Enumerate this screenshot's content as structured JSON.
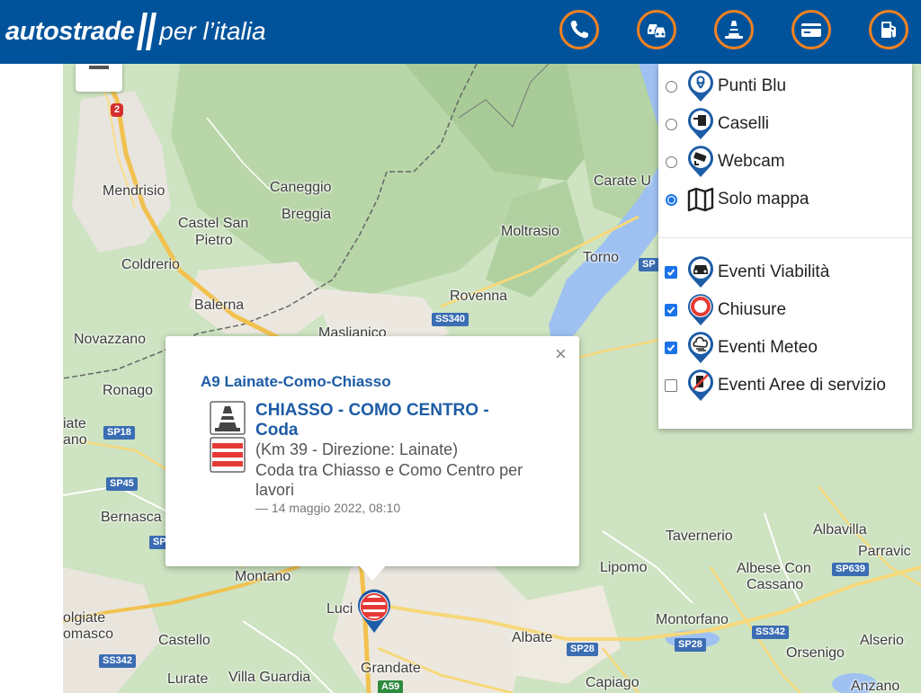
{
  "header": {
    "brand": "autostrade",
    "brand_sub": "per l’italia",
    "colors": {
      "bar": "#00539b",
      "accent": "#f58220"
    },
    "nav": [
      {
        "name": "phone-icon"
      },
      {
        "name": "traffic-cars-icon"
      },
      {
        "name": "roadworks-cone-icon"
      },
      {
        "name": "payment-card-icon"
      },
      {
        "name": "fuel-pump-icon"
      }
    ]
  },
  "map": {
    "places": [
      {
        "label": "Mendrisio"
      },
      {
        "label": "Caneggio"
      },
      {
        "label": "Breggia"
      },
      {
        "label": "Castel San"
      },
      {
        "label": "Pietro"
      },
      {
        "label": "Coldrerio"
      },
      {
        "label": "Balerna"
      },
      {
        "label": "Novazzano"
      },
      {
        "label": "Maslianico"
      },
      {
        "label": "Ronago"
      },
      {
        "label": "Moltrasio"
      },
      {
        "label": "Rovenna"
      },
      {
        "label": "Torno"
      },
      {
        "label": "Carate U"
      },
      {
        "label": "iate"
      },
      {
        "label": "ano"
      },
      {
        "label": "Bernasca"
      },
      {
        "label": "Montano"
      },
      {
        "label": "Luci"
      },
      {
        "label": "olgiate"
      },
      {
        "label": "omasco"
      },
      {
        "label": "Castello"
      },
      {
        "label": "Lurate"
      },
      {
        "label": "Villa Guardia"
      },
      {
        "label": "Grandate"
      },
      {
        "label": "Albate"
      },
      {
        "label": "Capiago"
      },
      {
        "label": "Tavernerio"
      },
      {
        "label": "Albavilla"
      },
      {
        "label": "Parravic"
      },
      {
        "label": "Lipomo"
      },
      {
        "label": "Albese Con"
      },
      {
        "label": "Cassano"
      },
      {
        "label": "Montorfano"
      },
      {
        "label": "Orsenigo"
      },
      {
        "label": "Alserio"
      },
      {
        "label": "Anzano"
      }
    ],
    "roads": [
      {
        "label": "2"
      },
      {
        "label": "SP18"
      },
      {
        "label": "SP45"
      },
      {
        "label": "SP"
      },
      {
        "label": "SS342"
      },
      {
        "label": "A59"
      },
      {
        "label": "SS340"
      },
      {
        "label": "SP"
      },
      {
        "label": "SP28"
      },
      {
        "label": "SP28"
      },
      {
        "label": "SS342"
      },
      {
        "label": "SP639"
      }
    ]
  },
  "layers": {
    "radio": [
      {
        "label": "Punti Blu",
        "checked": false,
        "icon": "blue-point-icon"
      },
      {
        "label": "Caselli",
        "checked": false,
        "icon": "toll-booth-icon"
      },
      {
        "label": "Webcam",
        "checked": false,
        "icon": "webcam-icon"
      },
      {
        "label": "Solo mappa",
        "checked": true,
        "icon": "map-icon"
      }
    ],
    "checks": [
      {
        "label": "Eventi Viabilità",
        "checked": true,
        "icon": "traffic-event-icon"
      },
      {
        "label": "Chiusure",
        "checked": true,
        "icon": "closure-icon"
      },
      {
        "label": "Eventi Meteo",
        "checked": true,
        "icon": "weather-icon"
      },
      {
        "label": "Eventi Aree di servizio",
        "checked": false,
        "icon": "service-area-icon"
      }
    ]
  },
  "popup": {
    "road": "A9 Lainate-Como-Chiasso",
    "title": "CHIASSO - COMO CENTRO - Coda",
    "km": "(Km 39 - Direzione: Lainate)",
    "description": "Coda tra Chiasso e Como Centro per lavori",
    "time": "— 14 maggio 2022, 08:10",
    "close": "×",
    "colors": {
      "title": "#1d5ca6",
      "closure": "#e53935"
    }
  }
}
